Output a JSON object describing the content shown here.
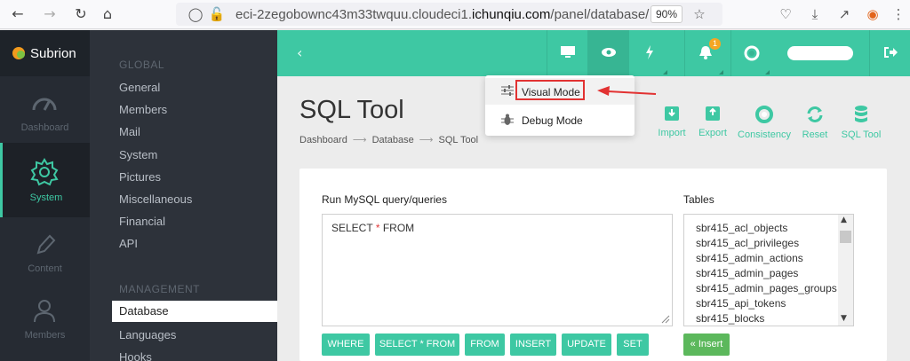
{
  "browser": {
    "url_prefix": "eci-2zegobownc43m33twquu.cloudeci1.",
    "url_domain": "ichunqiu.com",
    "url_path": "/panel/database/",
    "zoom": "90%"
  },
  "brand": {
    "name": "Subrion",
    "logo_colors": [
      "#f29b1d",
      "#7cc242"
    ]
  },
  "accent_color": "#3ec8a3",
  "icon_sidebar": [
    {
      "label": "Dashboard",
      "icon": "gauge-icon"
    },
    {
      "label": "System",
      "icon": "gear-icon",
      "active": true
    },
    {
      "label": "Content",
      "icon": "pencil-icon"
    },
    {
      "label": "Members",
      "icon": "user-icon"
    }
  ],
  "menu": {
    "global_heading": "GLOBAL",
    "global_items": [
      "General",
      "Members",
      "Mail",
      "System",
      "Pictures",
      "Miscellaneous",
      "Financial",
      "API"
    ],
    "management_heading": "MANAGEMENT",
    "management_items": [
      "Database",
      "Languages",
      "Hooks"
    ],
    "selected": "Database"
  },
  "topbar": {
    "icons": [
      "monitor-icon",
      "eye-icon",
      "bolt-icon",
      "bell-icon",
      "lifebuoy-icon",
      "logout-icon"
    ],
    "notification_count": "1"
  },
  "dropdown": {
    "items": [
      {
        "label": "Visual Mode",
        "icon": "sliders-icon"
      },
      {
        "label": "Debug Mode",
        "icon": "bug-icon"
      }
    ]
  },
  "page": {
    "title": "SQL Tool",
    "breadcrumb": [
      "Dashboard",
      "Database",
      "SQL Tool"
    ],
    "tools": [
      "Import",
      "Export",
      "Consistency",
      "Reset",
      "SQL Tool"
    ]
  },
  "sql": {
    "query_label": "Run MySQL query/queries",
    "query_before": "SELECT ",
    "query_star": "*",
    "query_after": " FROM",
    "tables_label": "Tables",
    "tables": [
      "sbr415_acl_objects",
      "sbr415_acl_privileges",
      "sbr415_admin_actions",
      "sbr415_admin_pages",
      "sbr415_admin_pages_groups",
      "sbr415_api_tokens",
      "sbr415_blocks"
    ],
    "buttons": [
      "WHERE",
      "SELECT * FROM",
      "FROM",
      "INSERT",
      "UPDATE",
      "SET"
    ],
    "insert_label": "« Insert"
  }
}
